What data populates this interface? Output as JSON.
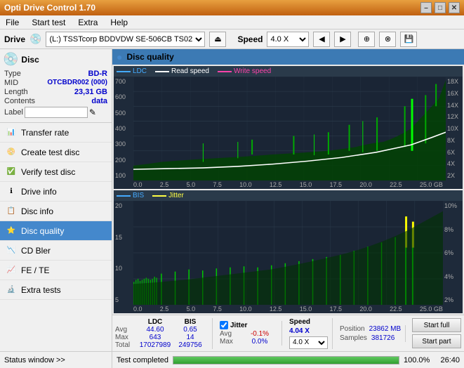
{
  "titlebar": {
    "title": "Opti Drive Control 1.70",
    "minimize": "–",
    "maximize": "□",
    "close": "✕"
  },
  "menubar": {
    "items": [
      "File",
      "Start test",
      "Extra",
      "Help"
    ]
  },
  "drivebar": {
    "label": "Drive",
    "drive_value": "(L:) TSSTcorp BDDVDW SE-506CB TS02",
    "speed_label": "Speed",
    "speed_value": "4.0 X"
  },
  "disc": {
    "type_label": "Type",
    "type_val": "BD-R",
    "mid_label": "MID",
    "mid_val": "OTCBDR002 (000)",
    "length_label": "Length",
    "length_val": "23,31 GB",
    "contents_label": "Contents",
    "contents_val": "data",
    "label_label": "Label",
    "label_placeholder": ""
  },
  "nav": {
    "items": [
      {
        "id": "transfer-rate",
        "label": "Transfer rate",
        "active": false
      },
      {
        "id": "create-test-disc",
        "label": "Create test disc",
        "active": false
      },
      {
        "id": "verify-test-disc",
        "label": "Verify test disc",
        "active": false
      },
      {
        "id": "drive-info",
        "label": "Drive info",
        "active": false
      },
      {
        "id": "disc-info",
        "label": "Disc info",
        "active": false
      },
      {
        "id": "disc-quality",
        "label": "Disc quality",
        "active": true
      },
      {
        "id": "cd-bler",
        "label": "CD Bler",
        "active": false
      },
      {
        "id": "fe-te",
        "label": "FE / TE",
        "active": false
      },
      {
        "id": "extra-tests",
        "label": "Extra tests",
        "active": false
      }
    ]
  },
  "chart": {
    "title": "Disc quality",
    "legend1": {
      "ldc_label": "LDC",
      "read_label": "Read speed",
      "write_label": "Write speed"
    },
    "legend2": {
      "bis_label": "BIS",
      "jitter_label": "Jitter"
    },
    "top_y_max": 700,
    "top_y_labels": [
      "700",
      "600",
      "500",
      "400",
      "300",
      "200",
      "100"
    ],
    "top_y_right": [
      "18X",
      "16X",
      "14X",
      "12X",
      "10X",
      "8X",
      "6X",
      "4X",
      "2X"
    ],
    "x_labels": [
      "0.0",
      "2.5",
      "5.0",
      "7.5",
      "10.0",
      "12.5",
      "15.0",
      "17.5",
      "20.0",
      "22.5",
      "25.0 GB"
    ],
    "bot_y_max": 20,
    "bot_y_labels": [
      "20",
      "15",
      "10",
      "5"
    ],
    "bot_y_right": [
      "10%",
      "8%",
      "6%",
      "4%",
      "2%"
    ]
  },
  "stats": {
    "ldc_header": "LDC",
    "bis_header": "BIS",
    "jitter_header": "Jitter",
    "speed_header": "Speed",
    "avg_label": "Avg",
    "max_label": "Max",
    "total_label": "Total",
    "ldc_avg": "44.60",
    "ldc_max": "643",
    "ldc_total": "17027989",
    "bis_avg": "0.65",
    "bis_max": "14",
    "bis_total": "249756",
    "jitter_avg": "-0.1%",
    "jitter_max": "0.0%",
    "speed_val": "4.04 X",
    "speed_dropdown": "4.0 X",
    "position_label": "Position",
    "position_val": "23862 MB",
    "samples_label": "Samples",
    "samples_val": "381726",
    "start_full": "Start full",
    "start_part": "Start part"
  },
  "statusbar": {
    "status_window": "Status window >>",
    "status_text": "Test completed",
    "progress": 100.0,
    "progress_pct": "100.0%",
    "time": "26:40"
  },
  "colors": {
    "accent": "#c06010",
    "active_nav": "#4488cc",
    "ldc_color": "#44aaff",
    "read_color": "#ffffff",
    "write_color": "#ff44aa",
    "bis_color": "#44aaff",
    "jitter_color": "#ffff00",
    "grid_color": "#2a3a4a",
    "ldc_fill": "#006600",
    "bis_fill": "#006600"
  }
}
